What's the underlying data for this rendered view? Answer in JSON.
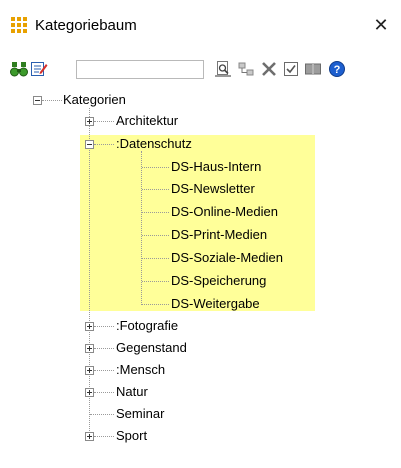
{
  "window": {
    "title": "Kategoriebaum",
    "close_glyph": "✕"
  },
  "toolbar": {
    "search": {
      "value": "",
      "placeholder": ""
    },
    "buttons": [
      "binoculars-icon",
      "edit-icon",
      "preview-icon",
      "link-icon",
      "delete-icon",
      "checkbox-icon",
      "book-icon",
      "help-icon"
    ]
  },
  "tree": {
    "root": "Kategorien",
    "nodes": [
      {
        "label": "Architektur",
        "expander": "plus"
      },
      {
        "label": ":Datenschutz",
        "expander": "minus",
        "highlighted": true
      },
      {
        "label": "DS-Haus-Intern",
        "child": true
      },
      {
        "label": "DS-Newsletter",
        "child": true
      },
      {
        "label": "DS-Online-Medien",
        "child": true
      },
      {
        "label": "DS-Print-Medien",
        "child": true
      },
      {
        "label": "DS-Soziale-Medien",
        "child": true
      },
      {
        "label": "DS-Speicherung",
        "child": true
      },
      {
        "label": "DS-Weitergabe",
        "child": true
      },
      {
        "label": ":Fotografie",
        "expander": "plus"
      },
      {
        "label": "Gegenstand",
        "expander": "plus"
      },
      {
        "label": ":Mensch",
        "expander": "plus"
      },
      {
        "label": "Natur",
        "expander": "plus"
      },
      {
        "label": "Seminar"
      },
      {
        "label": "Sport",
        "expander": "plus"
      }
    ]
  },
  "colors": {
    "highlight": "#ffff99",
    "accent_icon": "#e8a100",
    "help_icon": "#1d5fcf"
  }
}
